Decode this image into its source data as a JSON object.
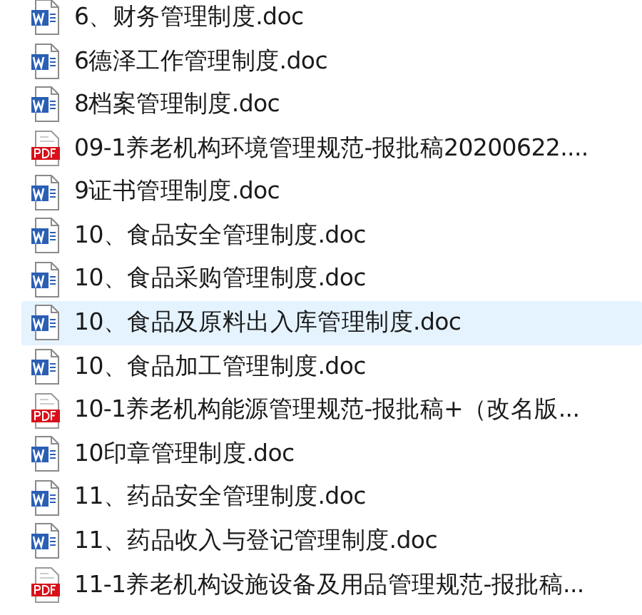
{
  "files": [
    {
      "name": "6、财务管理制度.doc",
      "kind": "word",
      "selected": false
    },
    {
      "name": "6德泽工作管理制度.doc",
      "kind": "word",
      "selected": false
    },
    {
      "name": "8档案管理制度.doc",
      "kind": "word",
      "selected": false
    },
    {
      "name": "09-1养老机构环境管理规范-报批稿20200622....",
      "kind": "pdf",
      "selected": false
    },
    {
      "name": "9证书管理制度.doc",
      "kind": "word",
      "selected": false
    },
    {
      "name": "10、食品安全管理制度.doc",
      "kind": "word",
      "selected": false
    },
    {
      "name": "10、食品采购管理制度.doc",
      "kind": "word",
      "selected": false
    },
    {
      "name": "10、食品及原料出入库管理制度.doc",
      "kind": "word",
      "selected": true
    },
    {
      "name": "10、食品加工管理制度.doc",
      "kind": "word",
      "selected": false
    },
    {
      "name": "10-1养老机构能源管理规范-报批稿+（改名版...",
      "kind": "pdf",
      "selected": false
    },
    {
      "name": "10印章管理制度.doc",
      "kind": "word",
      "selected": false
    },
    {
      "name": "11、药品安全管理制度.doc",
      "kind": "word",
      "selected": false
    },
    {
      "name": "11、药品收入与登记管理制度.doc",
      "kind": "word",
      "selected": false
    },
    {
      "name": "11-1养老机构设施设备及用品管理规范-报批稿...",
      "kind": "pdf",
      "selected": false
    }
  ]
}
